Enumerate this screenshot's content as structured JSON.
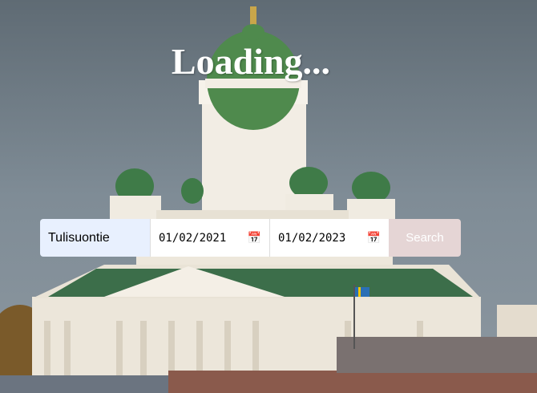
{
  "page": {
    "title": "Loading..."
  },
  "search_form": {
    "location_value": "Tulisuontie",
    "start_date": "01/02/2021",
    "end_date": "01/02/2023",
    "search_label": "Search"
  },
  "icons": {
    "calendar": "calendar-icon"
  },
  "colors": {
    "location_bg": "#e8f0fe",
    "search_bg": "#e5d5d5"
  }
}
